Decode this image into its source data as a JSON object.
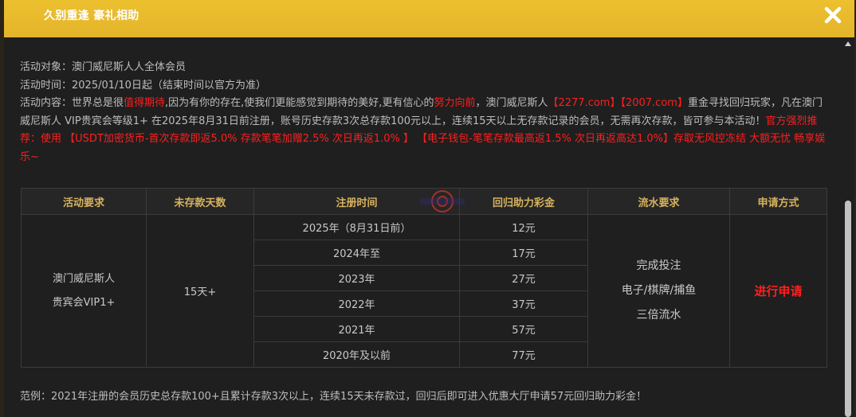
{
  "header": {
    "title": "久别重逢 豪礼相助",
    "close_icon": "close-icon"
  },
  "info": {
    "target_label": "活动对象：",
    "target_value": "澳门威尼斯人人全体会员",
    "time_label": "活动时间：",
    "time_value": "2025/01/10日起（结束时间以官方为准）",
    "content_label": "活动内容：",
    "content_1": "世界总是很",
    "content_red_1": "值得期待",
    "content_2": ",因为有你的存在,使我们更能感觉到期待的美好,更有信心的",
    "content_red_2": "努力向前",
    "content_3": "，澳门威尼斯人",
    "content_red_3": "【2277.com】【2007.com】",
    "content_4": "重金寻找回归玩家，凡在澳门威尼斯人 VIP贵宾会等级1+ 在2025年8月31日前注册，账号历史存款3次总存款100元以上，连续15天以上无存款记录的会员，无需再次存款，皆可参与本活动！",
    "content_red_4": "官方强烈推荐：使用 【USDT加密货币-首次存款即返5.0% 存款笔笔加赠2.5% 次日再返1.0% 】 【电子钱包-笔笔存款最高返1.5% 次日再返高达1.0%】存取无风控冻结 大额无忧 畅享娱乐~"
  },
  "table": {
    "headers": [
      "活动要求",
      "未存款天数",
      "注册时间",
      "回归助力彩金",
      "流水要求",
      "申请方式"
    ],
    "requirement_line1": "澳门威尼斯人",
    "requirement_line2": "贵宾会VIP1+",
    "days": "15天+",
    "rows": [
      {
        "reg": "2025年（8月31日前）",
        "bonus": "12元"
      },
      {
        "reg": "2024年至",
        "bonus": "17元"
      },
      {
        "reg": "2023年",
        "bonus": "27元"
      },
      {
        "reg": "2022年",
        "bonus": "37元"
      },
      {
        "reg": "2021年",
        "bonus": "57元"
      },
      {
        "reg": "2020年及以前",
        "bonus": "77元"
      }
    ],
    "wager_line1": "完成投注",
    "wager_line2": "电子/棋牌/捕鱼",
    "wager_line3": "三倍流水",
    "apply": "进行申请"
  },
  "example": "范例：2021年注册的会员历史总存款100+且累计存款3次以上，连续15天未存款过，回归后即可进入优惠大厅申请57元回归助力彩金！",
  "colors": {
    "header": "#e6b72c",
    "accent_gold": "#d6b25e",
    "red": "#ff1f1f",
    "bg": "#1f1f1f"
  }
}
